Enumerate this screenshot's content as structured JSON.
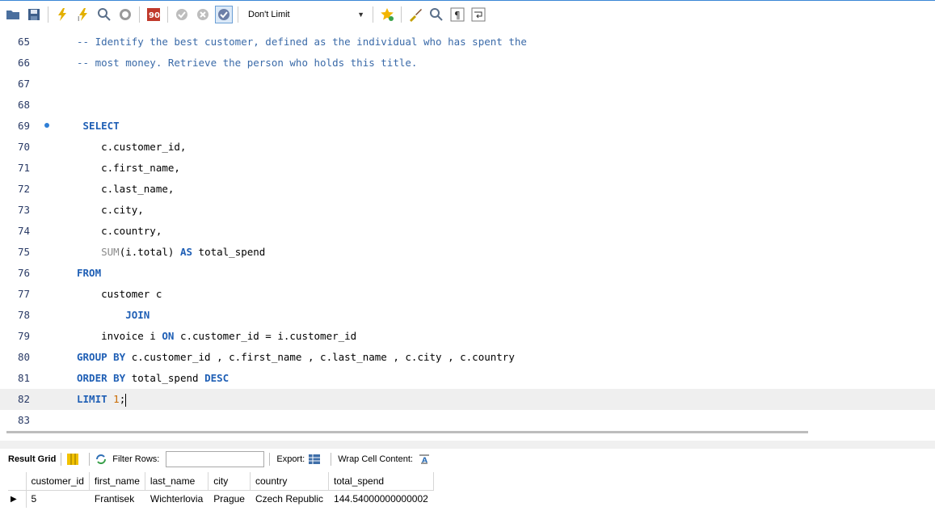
{
  "toolbar": {
    "limit_value": "Don't Limit",
    "icons": [
      "open-folder-icon",
      "save-icon",
      "execute-icon",
      "execute-current-icon",
      "explain-icon",
      "stop-icon",
      "toggle-error-icon",
      "commit-icon",
      "rollback-icon",
      "autocommit-icon",
      "beautify-icon",
      "bookmark-icon",
      "brush-icon",
      "find-icon",
      "invisibles-icon",
      "wrap-icon"
    ]
  },
  "editor": {
    "lines": [
      {
        "n": "65",
        "parts": [
          {
            "t": "-- Identify the best customer, defined as the individual who has spent the",
            "c": "cm"
          }
        ]
      },
      {
        "n": "66",
        "parts": [
          {
            "t": "-- most money. Retrieve the person who holds this title.",
            "c": "cm"
          }
        ]
      },
      {
        "n": "67",
        "parts": []
      },
      {
        "n": "68",
        "parts": []
      },
      {
        "n": "69",
        "marker": true,
        "parts": [
          {
            "t": " SELECT",
            "c": "kw"
          }
        ]
      },
      {
        "n": "70",
        "parts": [
          {
            "t": "    c.customer_id,",
            "c": ""
          }
        ]
      },
      {
        "n": "71",
        "parts": [
          {
            "t": "    c.first_name,",
            "c": ""
          }
        ]
      },
      {
        "n": "72",
        "parts": [
          {
            "t": "    c.last_name,",
            "c": ""
          }
        ]
      },
      {
        "n": "73",
        "parts": [
          {
            "t": "    c.city,",
            "c": ""
          }
        ]
      },
      {
        "n": "74",
        "parts": [
          {
            "t": "    c.country,",
            "c": ""
          }
        ]
      },
      {
        "n": "75",
        "parts": [
          {
            "t": "    SUM",
            "c": "fn"
          },
          {
            "t": "(i.total) ",
            "c": ""
          },
          {
            "t": "AS",
            "c": "kw"
          },
          {
            "t": " total_spend",
            "c": ""
          }
        ]
      },
      {
        "n": "76",
        "parts": [
          {
            "t": "FROM",
            "c": "kw"
          }
        ]
      },
      {
        "n": "77",
        "parts": [
          {
            "t": "    customer c",
            "c": ""
          }
        ]
      },
      {
        "n": "78",
        "parts": [
          {
            "t": "        JOIN",
            "c": "kw"
          }
        ]
      },
      {
        "n": "79",
        "parts": [
          {
            "t": "    invoice i ",
            "c": ""
          },
          {
            "t": "ON",
            "c": "kw"
          },
          {
            "t": " c.customer_id = i.customer_id",
            "c": ""
          }
        ]
      },
      {
        "n": "80",
        "parts": [
          {
            "t": "GROUP BY",
            "c": "kw"
          },
          {
            "t": " c.customer_id , c.first_name , c.last_name , c.city , c.country",
            "c": ""
          }
        ]
      },
      {
        "n": "81",
        "parts": [
          {
            "t": "ORDER BY",
            "c": "kw"
          },
          {
            "t": " total_spend ",
            "c": ""
          },
          {
            "t": "DESC",
            "c": "kw"
          }
        ]
      },
      {
        "n": "82",
        "current": true,
        "caret": true,
        "parts": [
          {
            "t": "LIMIT",
            "c": "kw"
          },
          {
            "t": " ",
            "c": ""
          },
          {
            "t": "1",
            "c": "num"
          },
          {
            "t": ";",
            "c": ""
          }
        ]
      },
      {
        "n": "83",
        "parts": []
      }
    ]
  },
  "result": {
    "title": "Result Grid",
    "filter_label": "Filter Rows:",
    "filter_value": "",
    "export_label": "Export:",
    "wrap_label": "Wrap Cell Content:",
    "columns": [
      "customer_id",
      "first_name",
      "last_name",
      "city",
      "country",
      "total_spend"
    ],
    "rows": [
      [
        "5",
        "Frantisek",
        "Wichterlovia",
        "Prague",
        "Czech Republic",
        "144.54000000000002"
      ]
    ],
    "row_indicator": "▶"
  }
}
